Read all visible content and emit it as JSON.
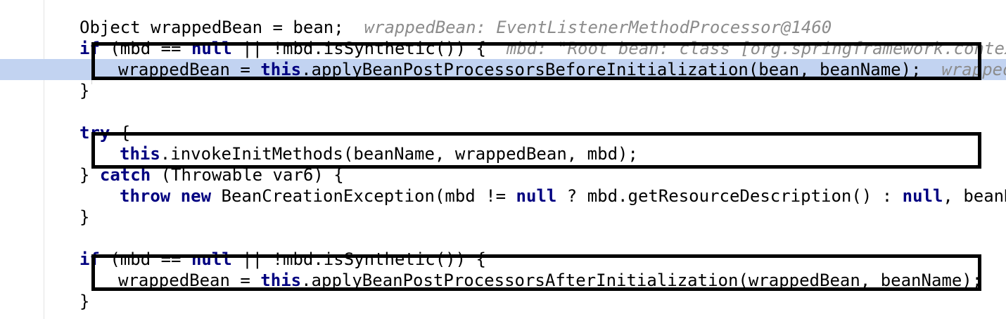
{
  "colors": {
    "keyword": "#000080",
    "text": "#000000",
    "hint": "#8c8c8c",
    "execution_line": "#c2d3f1",
    "annotation_box": "#000000"
  },
  "lines": [
    {
      "id": "l1",
      "tokens": [
        {
          "t": "Object wrappedBean = bean;  ",
          "c": "text"
        },
        {
          "t": "wrappedBean: EventListenerMethodProcessor@1460",
          "c": "hint"
        }
      ]
    },
    {
      "id": "l2",
      "tokens": [
        {
          "t": "if",
          "c": "kw"
        },
        {
          "t": " (mbd == ",
          "c": "text"
        },
        {
          "t": "null",
          "c": "kw"
        },
        {
          "t": " || !mbd.isSynthetic()) {  ",
          "c": "text"
        },
        {
          "t": "mbd: \"Root bean: class [org.springframework.context.e",
          "c": "hint"
        }
      ]
    },
    {
      "id": "l3",
      "highlight": true,
      "tokens": [
        {
          "t": "wrappedBean = ",
          "c": "text"
        },
        {
          "t": "this",
          "c": "kw"
        },
        {
          "t": ".applyBeanPostProcessorsBeforeInitialization(bean, beanName);  ",
          "c": "text"
        },
        {
          "t": "wrappedBea",
          "c": "hint"
        }
      ]
    },
    {
      "id": "l4",
      "tokens": [
        {
          "t": "}",
          "c": "text"
        }
      ]
    },
    {
      "id": "l5",
      "tokens": []
    },
    {
      "id": "l6",
      "tokens": [
        {
          "t": "try",
          "c": "kw"
        },
        {
          "t": " {",
          "c": "text"
        }
      ]
    },
    {
      "id": "l7",
      "tokens": [
        {
          "t": "this",
          "c": "kw"
        },
        {
          "t": ".invokeInitMethods(beanName, wrappedBean, mbd);",
          "c": "text"
        }
      ]
    },
    {
      "id": "l8",
      "tokens": [
        {
          "t": "} ",
          "c": "text"
        },
        {
          "t": "catch",
          "c": "kw"
        },
        {
          "t": " (Throwable var6) {",
          "c": "text"
        }
      ]
    },
    {
      "id": "l9",
      "tokens": [
        {
          "t": "throw",
          "c": "kw"
        },
        {
          "t": " ",
          "c": "text"
        },
        {
          "t": "new",
          "c": "kw"
        },
        {
          "t": " BeanCreationException(mbd != ",
          "c": "text"
        },
        {
          "t": "null",
          "c": "kw"
        },
        {
          "t": " ? mbd.getResourceDescription() : ",
          "c": "text"
        },
        {
          "t": "null",
          "c": "kw"
        },
        {
          "t": ", beanName",
          "c": "text"
        }
      ]
    },
    {
      "id": "l10",
      "tokens": [
        {
          "t": "}",
          "c": "text"
        }
      ]
    },
    {
      "id": "l11",
      "tokens": []
    },
    {
      "id": "l12",
      "tokens": [
        {
          "t": "if",
          "c": "kw"
        },
        {
          "t": " (mbd == ",
          "c": "text"
        },
        {
          "t": "null",
          "c": "kw"
        },
        {
          "t": " || !mbd.isSynthetic()) {",
          "c": "text"
        }
      ]
    },
    {
      "id": "l13",
      "tokens": [
        {
          "t": "wrappedBean = ",
          "c": "text"
        },
        {
          "t": "this",
          "c": "kw"
        },
        {
          "t": ".applyBeanPostProcessorsAfterInitialization(wrappedBean, beanName);",
          "c": "text"
        }
      ]
    },
    {
      "id": "l14",
      "tokens": [
        {
          "t": "}",
          "c": "text"
        }
      ]
    }
  ]
}
